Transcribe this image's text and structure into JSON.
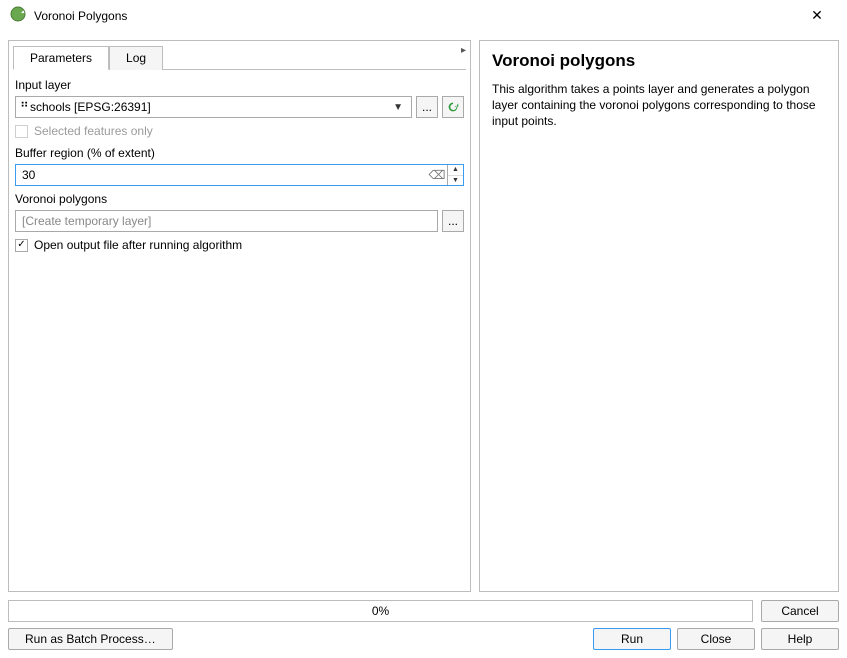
{
  "window": {
    "title": "Voronoi Polygons"
  },
  "tabs": {
    "parameters": "Parameters",
    "log": "Log"
  },
  "params": {
    "input_layer_label": "Input layer",
    "input_layer_value": "schools [EPSG:26391]",
    "browse_btn": "...",
    "selected_only_label": "Selected features only",
    "buffer_label": "Buffer region (% of extent)",
    "buffer_value": "30",
    "output_label": "Voronoi polygons",
    "output_placeholder": "[Create temporary layer]",
    "output_browse_btn": "...",
    "open_output_label": "Open output file after running algorithm"
  },
  "help": {
    "title": "Voronoi polygons",
    "body": "This algorithm takes a points layer and generates a polygon layer containing the voronoi polygons corresponding to those input points."
  },
  "footer": {
    "progress_text": "0%",
    "cancel": "Cancel",
    "batch": "Run as Batch Process…",
    "run": "Run",
    "close": "Close",
    "help_btn": "Help"
  },
  "icons": {
    "point_layer": "⠛",
    "reload": "↻",
    "clear": "⌫"
  }
}
